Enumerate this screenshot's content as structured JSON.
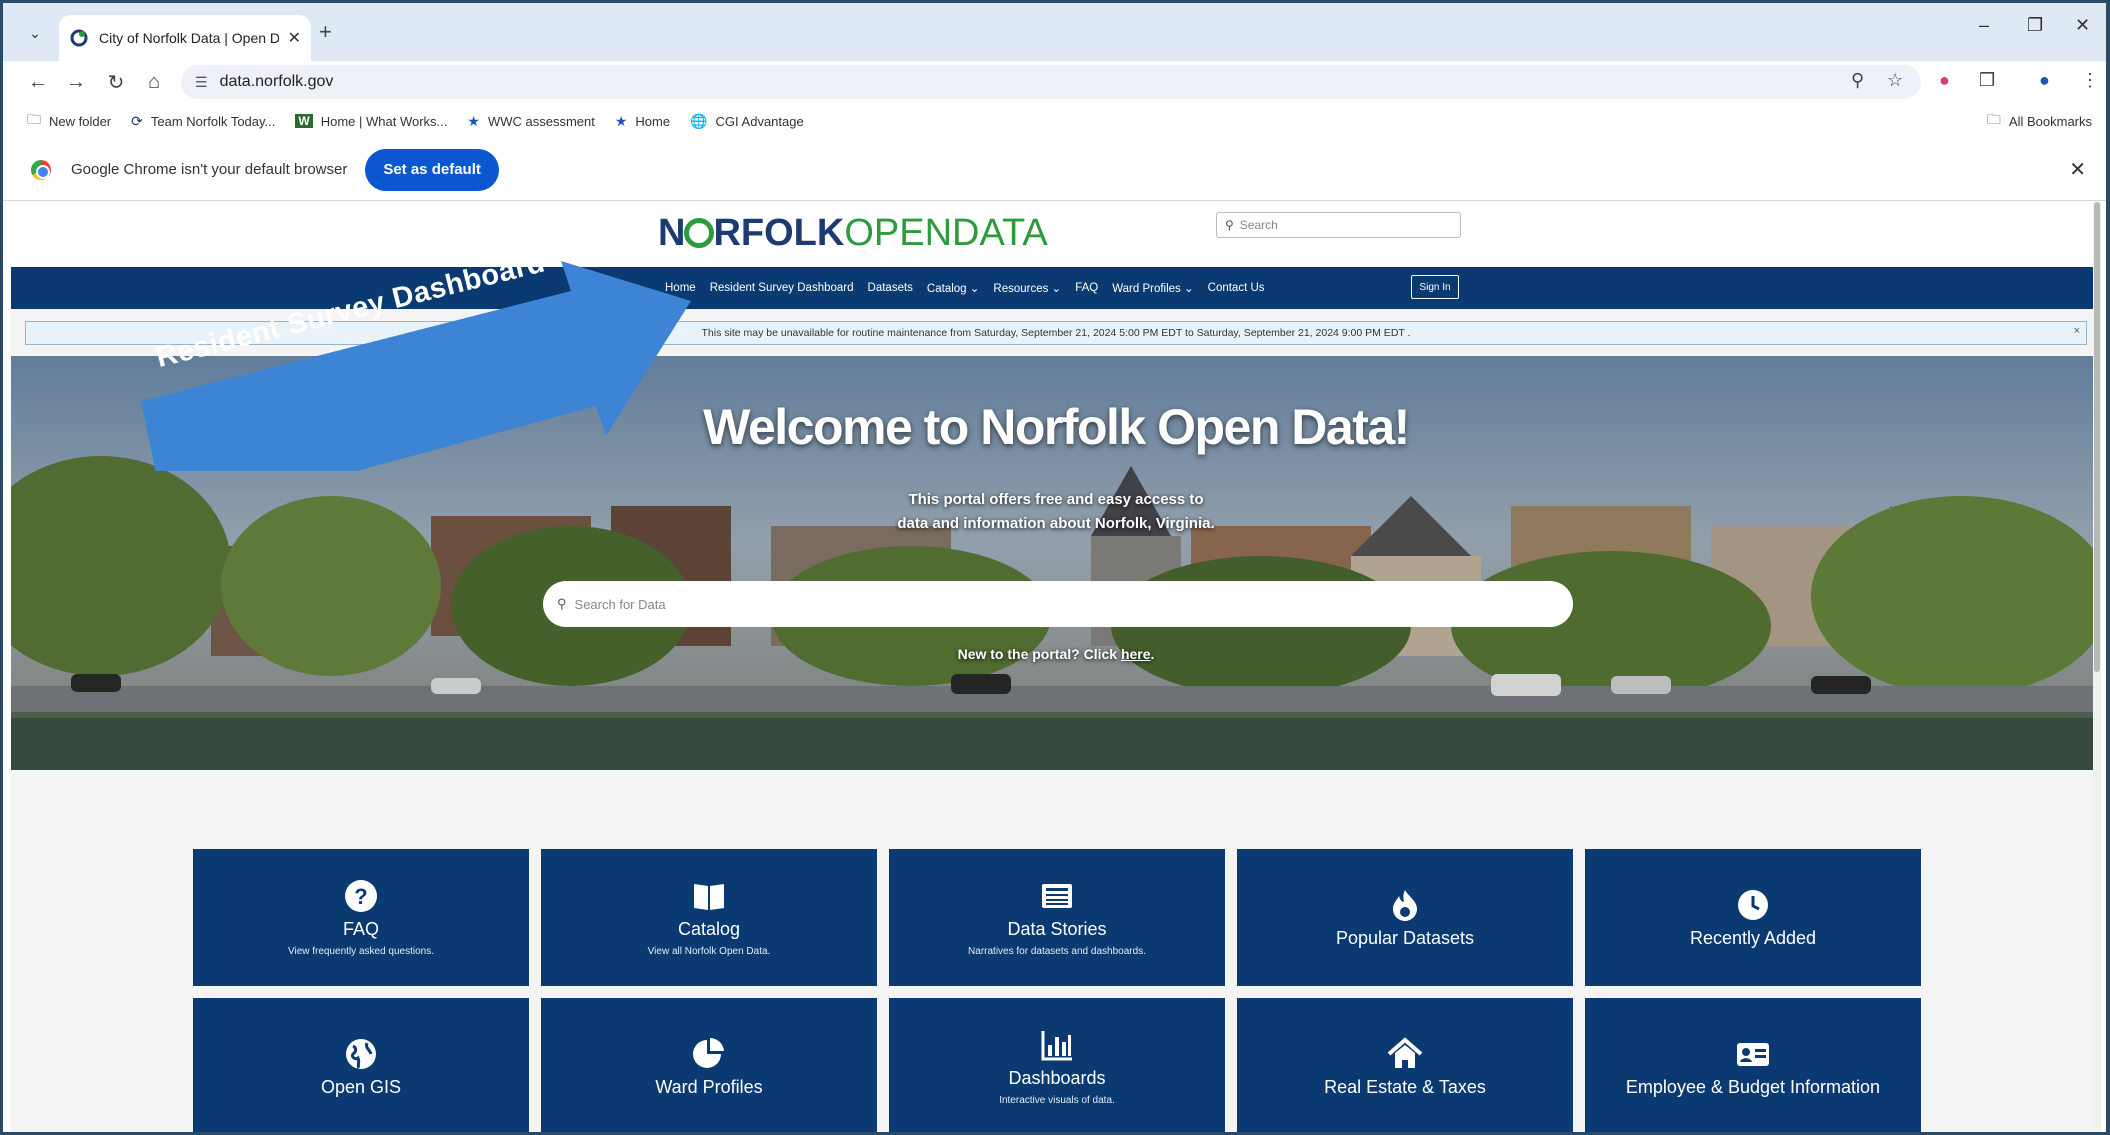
{
  "browser": {
    "tab_title": "City of Norfolk Data | Open Dat",
    "url": "data.norfolk.gov",
    "bookmarks": [
      {
        "icon": "folder-icon",
        "label": "New folder"
      },
      {
        "icon": "norfolk-favicon",
        "label": "Team Norfolk Today..."
      },
      {
        "icon": "w-favicon",
        "label": "Home | What Works..."
      },
      {
        "icon": "star-favicon",
        "label": "WWC assessment"
      },
      {
        "icon": "star-favicon",
        "label": "Home"
      },
      {
        "icon": "globe-favicon",
        "label": "CGI Advantage"
      }
    ],
    "all_bookmarks": "All Bookmarks",
    "infobar": {
      "text": "Google Chrome isn't your default browser",
      "button": "Set as default"
    }
  },
  "site": {
    "logo": {
      "part1": "N",
      "part2": "RFOLK",
      "part3": "OPENDATA"
    },
    "search_placeholder": "Search",
    "nav": [
      "Home",
      "Resident Survey Dashboard",
      "Datasets",
      "Catalog ⌄",
      "Resources ⌄",
      "FAQ",
      "Ward Profiles ⌄",
      "Contact Us"
    ],
    "sign_in": "Sign In",
    "maintenance": "This site may be unavailable for routine maintenance from  Saturday, September 21, 2024 5:00 PM EDT  to  Saturday, September 21, 2024 9:00 PM EDT .",
    "hero": {
      "title": "Welcome to Norfolk Open Data!",
      "sub1": "This portal offers free and easy access to",
      "sub2": "data and information about Norfolk, Virginia.",
      "search_placeholder": "Search for Data",
      "new_text": "New to the portal? Click ",
      "new_link": "here",
      "new_end": "."
    },
    "annotation": "Resident Survey Dashboard",
    "tiles": [
      {
        "icon": "question-icon",
        "title": "FAQ",
        "desc": "View frequently asked questions."
      },
      {
        "icon": "book-icon",
        "title": "Catalog",
        "desc": "View all Norfolk Open Data."
      },
      {
        "icon": "newspaper-icon",
        "title": "Data Stories",
        "desc": "Narratives for datasets and dashboards."
      },
      {
        "icon": "fire-icon",
        "title": "Popular Datasets",
        "desc": ""
      },
      {
        "icon": "clock-icon",
        "title": "Recently Added",
        "desc": ""
      },
      {
        "icon": "globe-icon",
        "title": "Open GIS",
        "desc": ""
      },
      {
        "icon": "pie-chart-icon",
        "title": "Ward Profiles",
        "desc": ""
      },
      {
        "icon": "bar-chart-icon",
        "title": "Dashboards",
        "desc": "Interactive visuals of data."
      },
      {
        "icon": "house-icon",
        "title": "Real Estate & Taxes",
        "desc": ""
      },
      {
        "icon": "id-card-icon",
        "title": "Employee & Budget Information",
        "desc": ""
      }
    ]
  },
  "colors": {
    "navy": "#0b3a73",
    "green": "#2e9a3e",
    "chrome_blue": "#0b57d0",
    "arrow_blue": "#3d85d4"
  }
}
